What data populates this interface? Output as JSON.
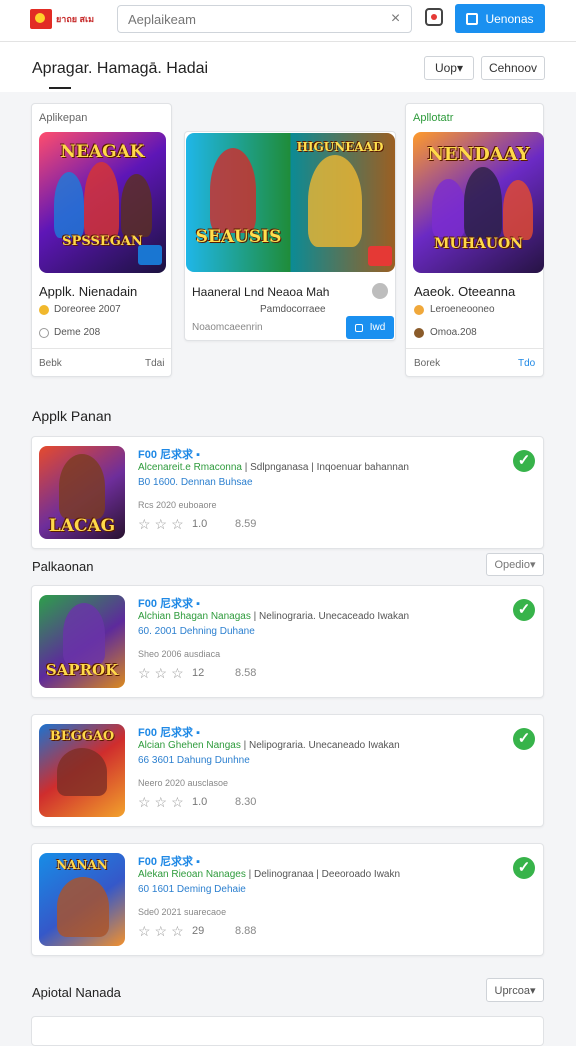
{
  "header": {
    "logo_text": "ยาถย สเม",
    "search_placeholder": "Aeplaikeam",
    "cta_label": "Uenonas"
  },
  "page": {
    "title": "Apragar. Hamagā. Hadai",
    "sort_label": "Uop▾",
    "filter_label": "Cehnoov"
  },
  "featured": [
    {
      "label": "Aplikepan",
      "art_title": "NEAGAK",
      "art_sub": "SPSSEGAN",
      "title": "Applk. Nienadain",
      "meta": "Doreoree 2007",
      "sub": "Deme 208",
      "footer_left": "Bebk",
      "footer_right": "Tdai"
    },
    {
      "label": "",
      "art_title": "SEAUSIS",
      "art_sub": "HIGUNEAAD",
      "title": "Haaneral Lnd Neaoa Mah",
      "meta": "Pamdocorraee",
      "sub": "Noaomcaeenrin",
      "button": "Iwd",
      "footer_left": "",
      "footer_right": ""
    },
    {
      "label": "Apllotatr",
      "art_title": "NENDAAY",
      "art_sub": "MUHAUON",
      "title": "Aaeok. Oteeanna",
      "meta": "Leroeneooneo",
      "sub": "Omoa.208",
      "footer_left": "Borek",
      "footer_right": "Tdo"
    }
  ],
  "sections": {
    "recommended_title": "Applk Panan",
    "popular_title": "Palkaonan",
    "popular_sort": "Opedio▾",
    "bottom_title": "Apiotal Nanada",
    "bottom_sort": "Uprcoa▾"
  },
  "apps": [
    {
      "title": "F00 尼求求 ▪",
      "desc_green": "Alcenareit.e Rmaconna",
      "desc": " | Sdlpnganasa | Inqoenuar bahannan",
      "meta": "B0 1600. Dennan Buhsae",
      "small": "Rcs 2020 euboaore",
      "rating": "1.0",
      "size": "8.59",
      "art": "LACAG"
    },
    {
      "title": "F00 尼求求 ▪",
      "desc_green": "Alchian Bhagan Nanagas",
      "desc": " | Nelinograria. Unecaceado Iwakan",
      "meta": "60. 2001 Dehning Duhane",
      "small": "Sheo 2006 ausdiaca",
      "rating": "12",
      "size": "8.58",
      "art": "SAPROK"
    },
    {
      "title": "F00 尼求求 ▪",
      "desc_green": "Alcian Ghehen Nangas",
      "desc": " | Nelipograria. Unecaneado Iwakan",
      "meta": "66 3601 Dahung Dunhne",
      "small": "Neero 2020 ausclasoe",
      "rating": "1.0",
      "size": "8.30",
      "art": "BEGGAO"
    },
    {
      "title": "F00 尼求求 ▪",
      "desc_green": "Alekan Rieoan Nanages",
      "desc": " | Delinogranaa | Deeoroado Iwakn",
      "meta": "60 1601 Deming Dehaie",
      "small": "Sde0 2021 suarecaoe",
      "rating": "29",
      "size": "8.88",
      "art": "NANAN"
    }
  ],
  "colors": {
    "accent": "#1a90f0",
    "success": "#37b34a",
    "link": "#1e88e5"
  }
}
